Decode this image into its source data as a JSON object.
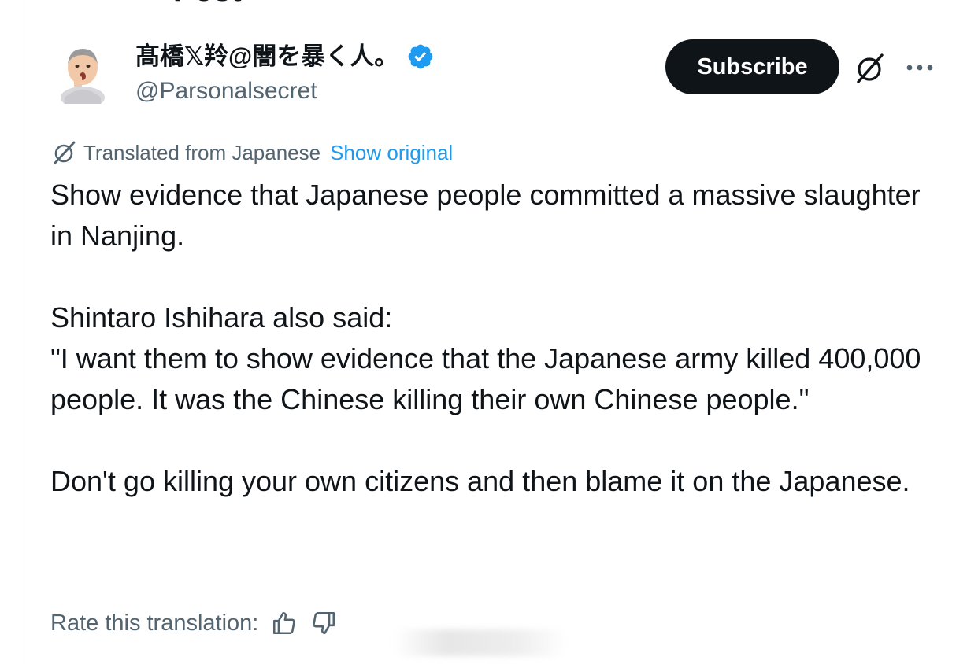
{
  "header": {
    "title": "Post"
  },
  "author": {
    "display_name": "髙橋𝕏羚@闇を暴く人。",
    "handle": "@Parsonalsecret",
    "verified_color": "#1d9bf0"
  },
  "actions": {
    "subscribe_label": "Subscribe",
    "grok_icon": "grok-icon",
    "more_icon": "more-icon"
  },
  "translation": {
    "label": "Translated from Japanese",
    "show_original": "Show original",
    "rate_label": "Rate this translation:"
  },
  "post": {
    "paragraph1": "Show evidence that Japanese people committed a massive slaughter in Nanjing.",
    "paragraph2_line1": "Shintaro Ishihara also said:",
    "paragraph2_line2": "\"I want them to show evidence that the Japanese army killed 400,000 people. It was the Chinese killing their own Chinese people.\"",
    "paragraph3": "Don't go killing your own citizens and then blame it on the Japanese."
  },
  "colors": {
    "text": "#0f1419",
    "secondary": "#536471",
    "link": "#1d9bf0",
    "button_bg": "#0f1419"
  }
}
